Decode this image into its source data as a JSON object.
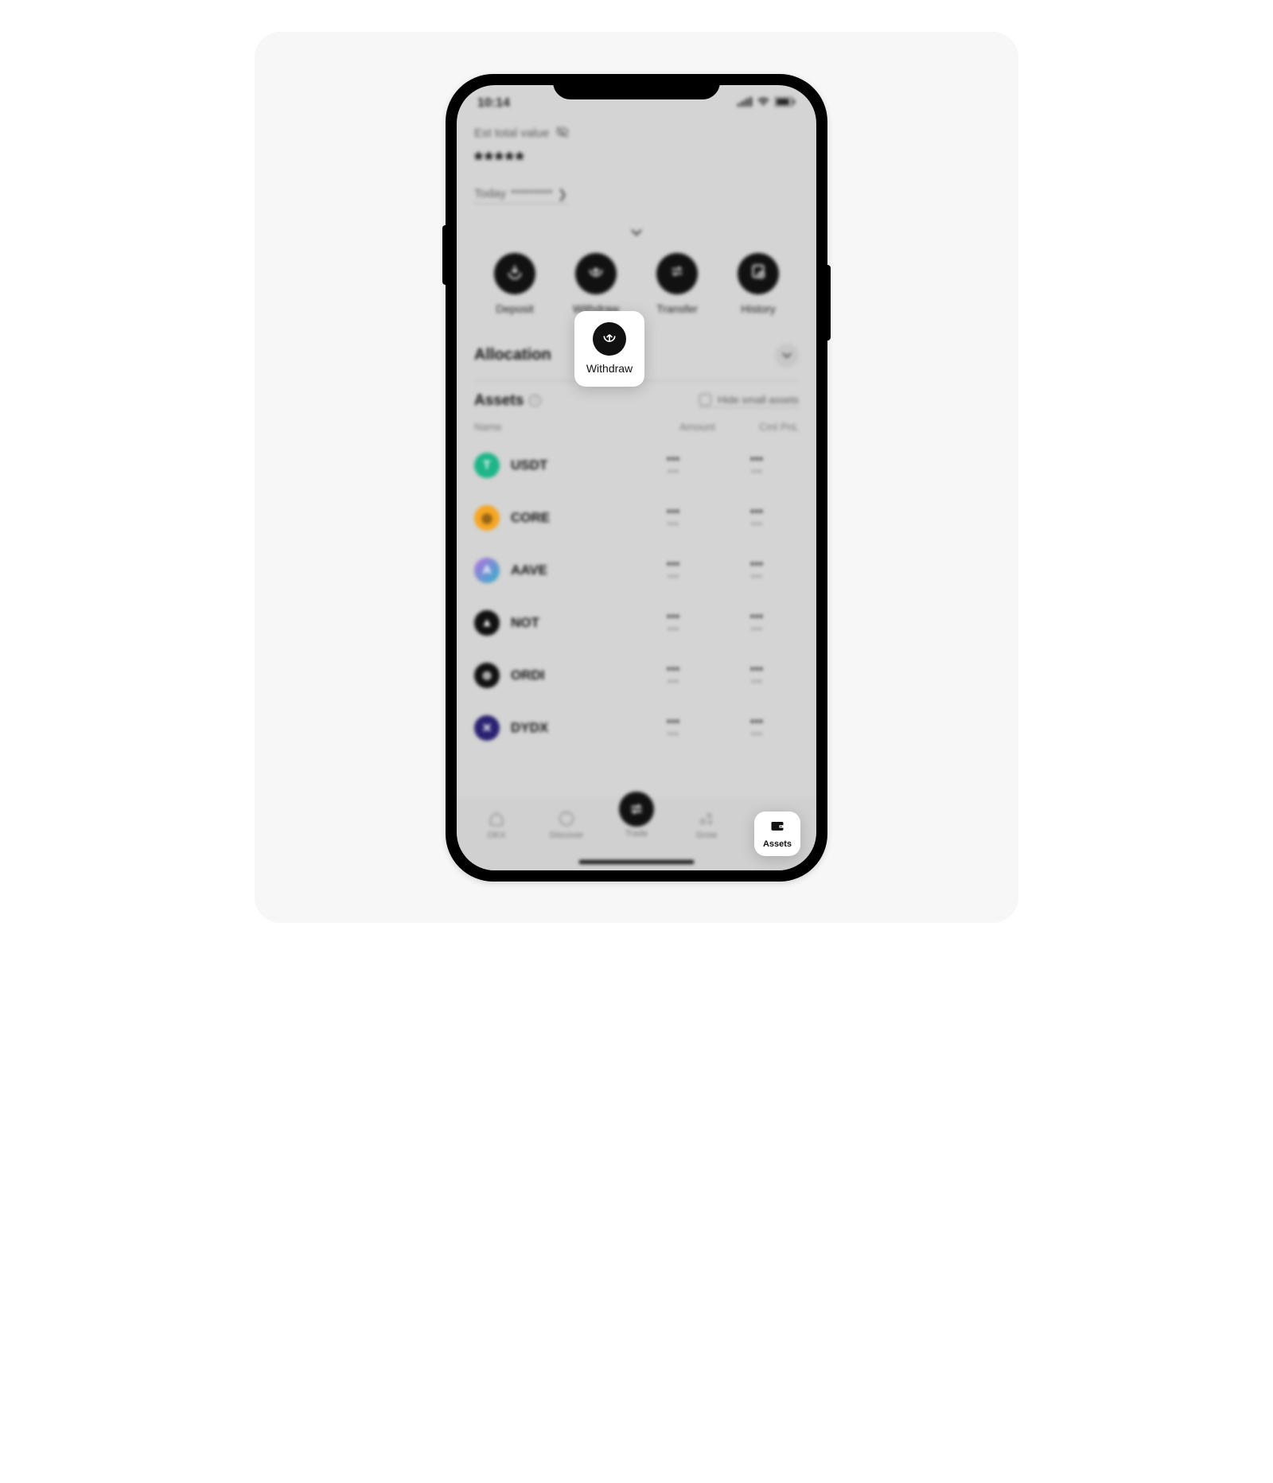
{
  "status_bar": {
    "time": "10:14"
  },
  "header": {
    "est_label": "Est total value",
    "masked_value": "*****",
    "today_label": "Today",
    "today_masked": "*********"
  },
  "actions": {
    "deposit": "Deposit",
    "withdraw": "Withdraw",
    "transfer": "Transfer",
    "history": "History"
  },
  "sections": {
    "allocation": "Allocation",
    "assets": "Assets",
    "hide_small": "Hide small assets"
  },
  "columns": {
    "name": "Name",
    "amount": "Amount",
    "pnl": "Cml PnL"
  },
  "assets": [
    {
      "symbol": "USDT",
      "icon_bg": "#1eb589",
      "icon_text": "T",
      "icon_fg": "#ffffff",
      "amount": "•••",
      "amount2": "•••",
      "pnl": "•••",
      "pnl2": "•••"
    },
    {
      "symbol": "CORE",
      "icon_bg": "#f5a623",
      "icon_text": "◎",
      "icon_fg": "#2b1b05",
      "amount": "•••",
      "amount2": "•••",
      "pnl": "•••",
      "pnl2": "•••"
    },
    {
      "symbol": "AAVE",
      "icon_bg": "linear-gradient(135deg,#b66fe0,#30b3c7)",
      "icon_text": "A",
      "icon_fg": "#ffffff",
      "amount": "•••",
      "amount2": "•••",
      "pnl": "•••",
      "pnl2": "•••"
    },
    {
      "symbol": "NOT",
      "icon_bg": "#111111",
      "icon_text": "▲",
      "icon_fg": "#ffffff",
      "amount": "•••",
      "amount2": "•••",
      "pnl": "•••",
      "pnl2": "•••"
    },
    {
      "symbol": "ORDI",
      "icon_bg": "#111111",
      "icon_text": "⊚",
      "icon_fg": "#ffffff",
      "amount": "•••",
      "amount2": "•••",
      "pnl": "•••",
      "pnl2": "•••"
    },
    {
      "symbol": "DYDX",
      "icon_bg": "#2a2271",
      "icon_text": "✕",
      "icon_fg": "#ffffff",
      "amount": "•••",
      "amount2": "•••",
      "pnl": "•••",
      "pnl2": "•••"
    }
  ],
  "nav": {
    "okx": "OKX",
    "discover": "Discover",
    "trade": "Trade",
    "grow": "Grow",
    "assets": "Assets"
  }
}
